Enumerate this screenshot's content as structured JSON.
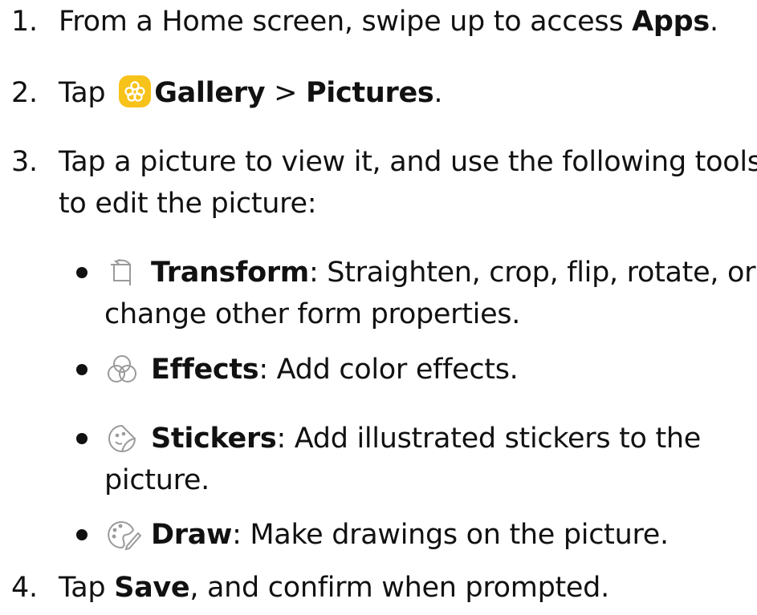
{
  "steps": [
    {
      "number": "1.",
      "text_a": "From a Home screen, swipe up to access ",
      "bold_a": "Apps",
      "text_b": "."
    },
    {
      "number": "2.",
      "text_a": "Tap ",
      "icon": "gallery-icon",
      "bold_a": "Gallery",
      "separator": " > ",
      "bold_b": "Pictures",
      "text_b": "."
    },
    {
      "number": "3.",
      "line1": "Tap a picture to view it, and use the following tools",
      "line2": "to edit the picture:",
      "tools": [
        {
          "icon": "transform-icon",
          "name": "Transform",
          "desc_line1": ": Straighten, crop, flip, rotate, or",
          "desc_line2": "change other form properties."
        },
        {
          "icon": "effects-icon",
          "name": "Effects",
          "desc_line1": ": Add color effects."
        },
        {
          "icon": "stickers-icon",
          "name": "Stickers",
          "desc_line1": ": Add illustrated stickers to the",
          "desc_line2": "picture."
        },
        {
          "icon": "draw-icon",
          "name": "Draw",
          "desc_line1": ": Make drawings on the picture."
        }
      ]
    },
    {
      "number": "4.",
      "text_a": "Tap ",
      "bold_a": "Save",
      "text_b": ", and confirm when prompted."
    }
  ],
  "colors": {
    "text": "#111111",
    "gallery_icon_bg": "#f7c21a",
    "icon_stroke": "#9a9a9a"
  }
}
